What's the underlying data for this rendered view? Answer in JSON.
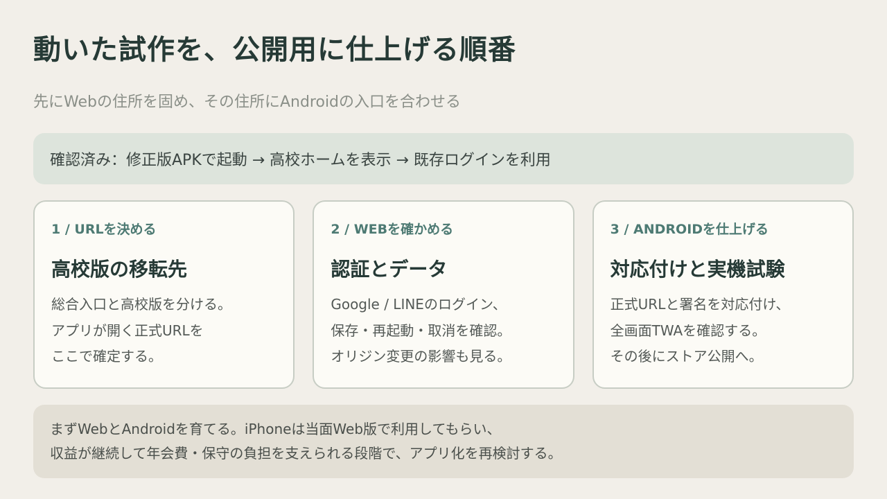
{
  "title": "動いた試作を、公開用に仕上げる順番",
  "subtitle": "先にWebの住所を固め、その住所にAndroidの入口を合わせる",
  "status_banner": "確認済み：修正版APKで起動 → 高校ホームを表示 → 既存ログインを利用",
  "cards": [
    {
      "step": "1 / URLを決める",
      "title": "高校版の移転先",
      "lines": [
        "総合入口と高校版を分ける。",
        "アプリが開く正式URLを",
        "ここで確定する。"
      ]
    },
    {
      "step": "2 / WEBを確かめる",
      "title": "認証とデータ",
      "lines": [
        "Google / LINEのログイン、",
        "保存・再起動・取消を確認。",
        "オリジン変更の影響も見る。"
      ]
    },
    {
      "step": "3 / ANDROIDを仕上げる",
      "title": "対応付けと実機試験",
      "lines": [
        "正式URLと署名を対応付け、",
        "全画面TWAを確認する。",
        "その後にストア公開へ。"
      ]
    }
  ],
  "footer": {
    "lines": [
      "まずWebとAndroidを育てる。iPhoneは当面Web版で利用してもらい、",
      "収益が継続して年会費・保守の負担を支えられる段階で、アプリ化を再検討する。"
    ]
  },
  "colors": {
    "background": "#f2efe9",
    "title": "#263a36",
    "accent": "#4d7a73",
    "banner": "#dde4dc",
    "card": "#fcfbf6",
    "footer": "#e3dfd5"
  }
}
